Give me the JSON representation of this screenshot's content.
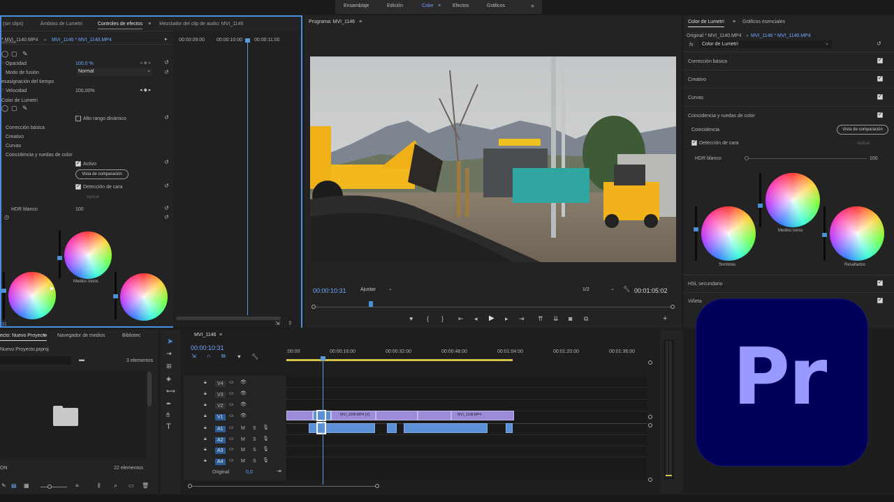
{
  "workspaces": {
    "tabs": [
      "Ensamblaje",
      "Edición",
      "Color",
      "Efectos",
      "Gráficos"
    ],
    "more": "»"
  },
  "effect_controls": {
    "tabs": [
      "(sin clips)",
      "Ámbitos de Lumetri",
      "Controles de efectos",
      "Mezclador del clip de audio: MVI_1146"
    ],
    "clip_source": "* MVI_1140.MP4",
    "clip_target": "MVI_1146 * MVI_1140.MP4",
    "partial_label": "opacidad",
    "timecodes": [
      "00:00:09:00",
      "00:00:10:00",
      "00:00:11:00"
    ],
    "opacity_label": "Opacidad",
    "opacity_value": "100,0 %",
    "blend_label": "Modo de fusión",
    "blend_value": "Normal",
    "time_remap_label": "esasignación del tiempo",
    "speed_label": "Velocidad",
    "speed_value": "100,00%",
    "lumetri_label": "Color de Lumetri",
    "hdr_label": "Alto rango dinámico",
    "sections": [
      "Corrección básica",
      "Creativo",
      "Curvas",
      "Coincidencia y ruedas de color"
    ],
    "active_label": "Activo",
    "compare_button": "Vista de comparación",
    "face_detect_label": "Detección de cara",
    "apply_button": "Aplicar",
    "hdr_white_label": "HDR blanco",
    "hdr_white_value": "100",
    "midtones_label": "Medios tonos",
    "bottom_timecode": "31"
  },
  "program": {
    "title": "Programa: MVI_1146",
    "timecode": "00:00:10:31",
    "fit": "Ajustar",
    "resolution": "1/2",
    "duration": "00:01:05:02",
    "playhead_fraction": 0.16
  },
  "lumetri_panel": {
    "tabs": [
      "Color de Lumetri",
      "Gráficos esenciales"
    ],
    "clip_source": "Original * MVI_1140.MP4",
    "clip_target": "MVI_1146 * MVI_1140.MP4",
    "fx_label": "fx",
    "effect_name": "Color de Lumetri",
    "sections": [
      "Corrección básica",
      "Creativo",
      "Curvas",
      "Coincidencia y ruedas de color"
    ],
    "match_label": "Coincidencia",
    "compare_button": "Vista de comparación",
    "face_detect_label": "Detección de cara",
    "apply_button": "Aplicar",
    "hdr_white_label": "HDR blanco",
    "hdr_white_value": "100",
    "wheels": [
      "Sombras",
      "Medios tonos",
      "Resaltados"
    ],
    "bottom_sections": [
      "HSL secundario",
      "Viñeta"
    ]
  },
  "project": {
    "tabs": [
      "ecto: Nuevo Proyecto",
      "Navegador de medios",
      "Bibliotec"
    ],
    "file": "Nuevo Proyecto.prproj",
    "count_top": "3 elementos",
    "status_left": "ON",
    "count_bottom": "22 elementos"
  },
  "timeline": {
    "sequence": "MVI_1146",
    "timecode": "00:00:10:31",
    "ruler": [
      ":00:00",
      "00:00:16:00",
      "00:00:32:00",
      "00:00:48:00",
      "00:01:04:00",
      "00:01:20:00",
      "00:01:36:00"
    ],
    "video_tracks": [
      "V4",
      "V3",
      "V2",
      "V1"
    ],
    "audio_tracks": [
      "A1",
      "A2",
      "A3",
      "A4"
    ],
    "master_label": "Original",
    "master_value": "0,0",
    "audio_buttons": [
      "M",
      "S"
    ],
    "clip_names": [
      "MVI_1096.MP4 [V]",
      "MVI_1108.MP4"
    ]
  },
  "badge": {
    "text": "Pr",
    "bg": "#00005b",
    "fg": "#9999ff"
  },
  "colors": {
    "accent_blue": "#4b8fd6",
    "panel": "#232323",
    "border_active": "#4a90e2"
  }
}
